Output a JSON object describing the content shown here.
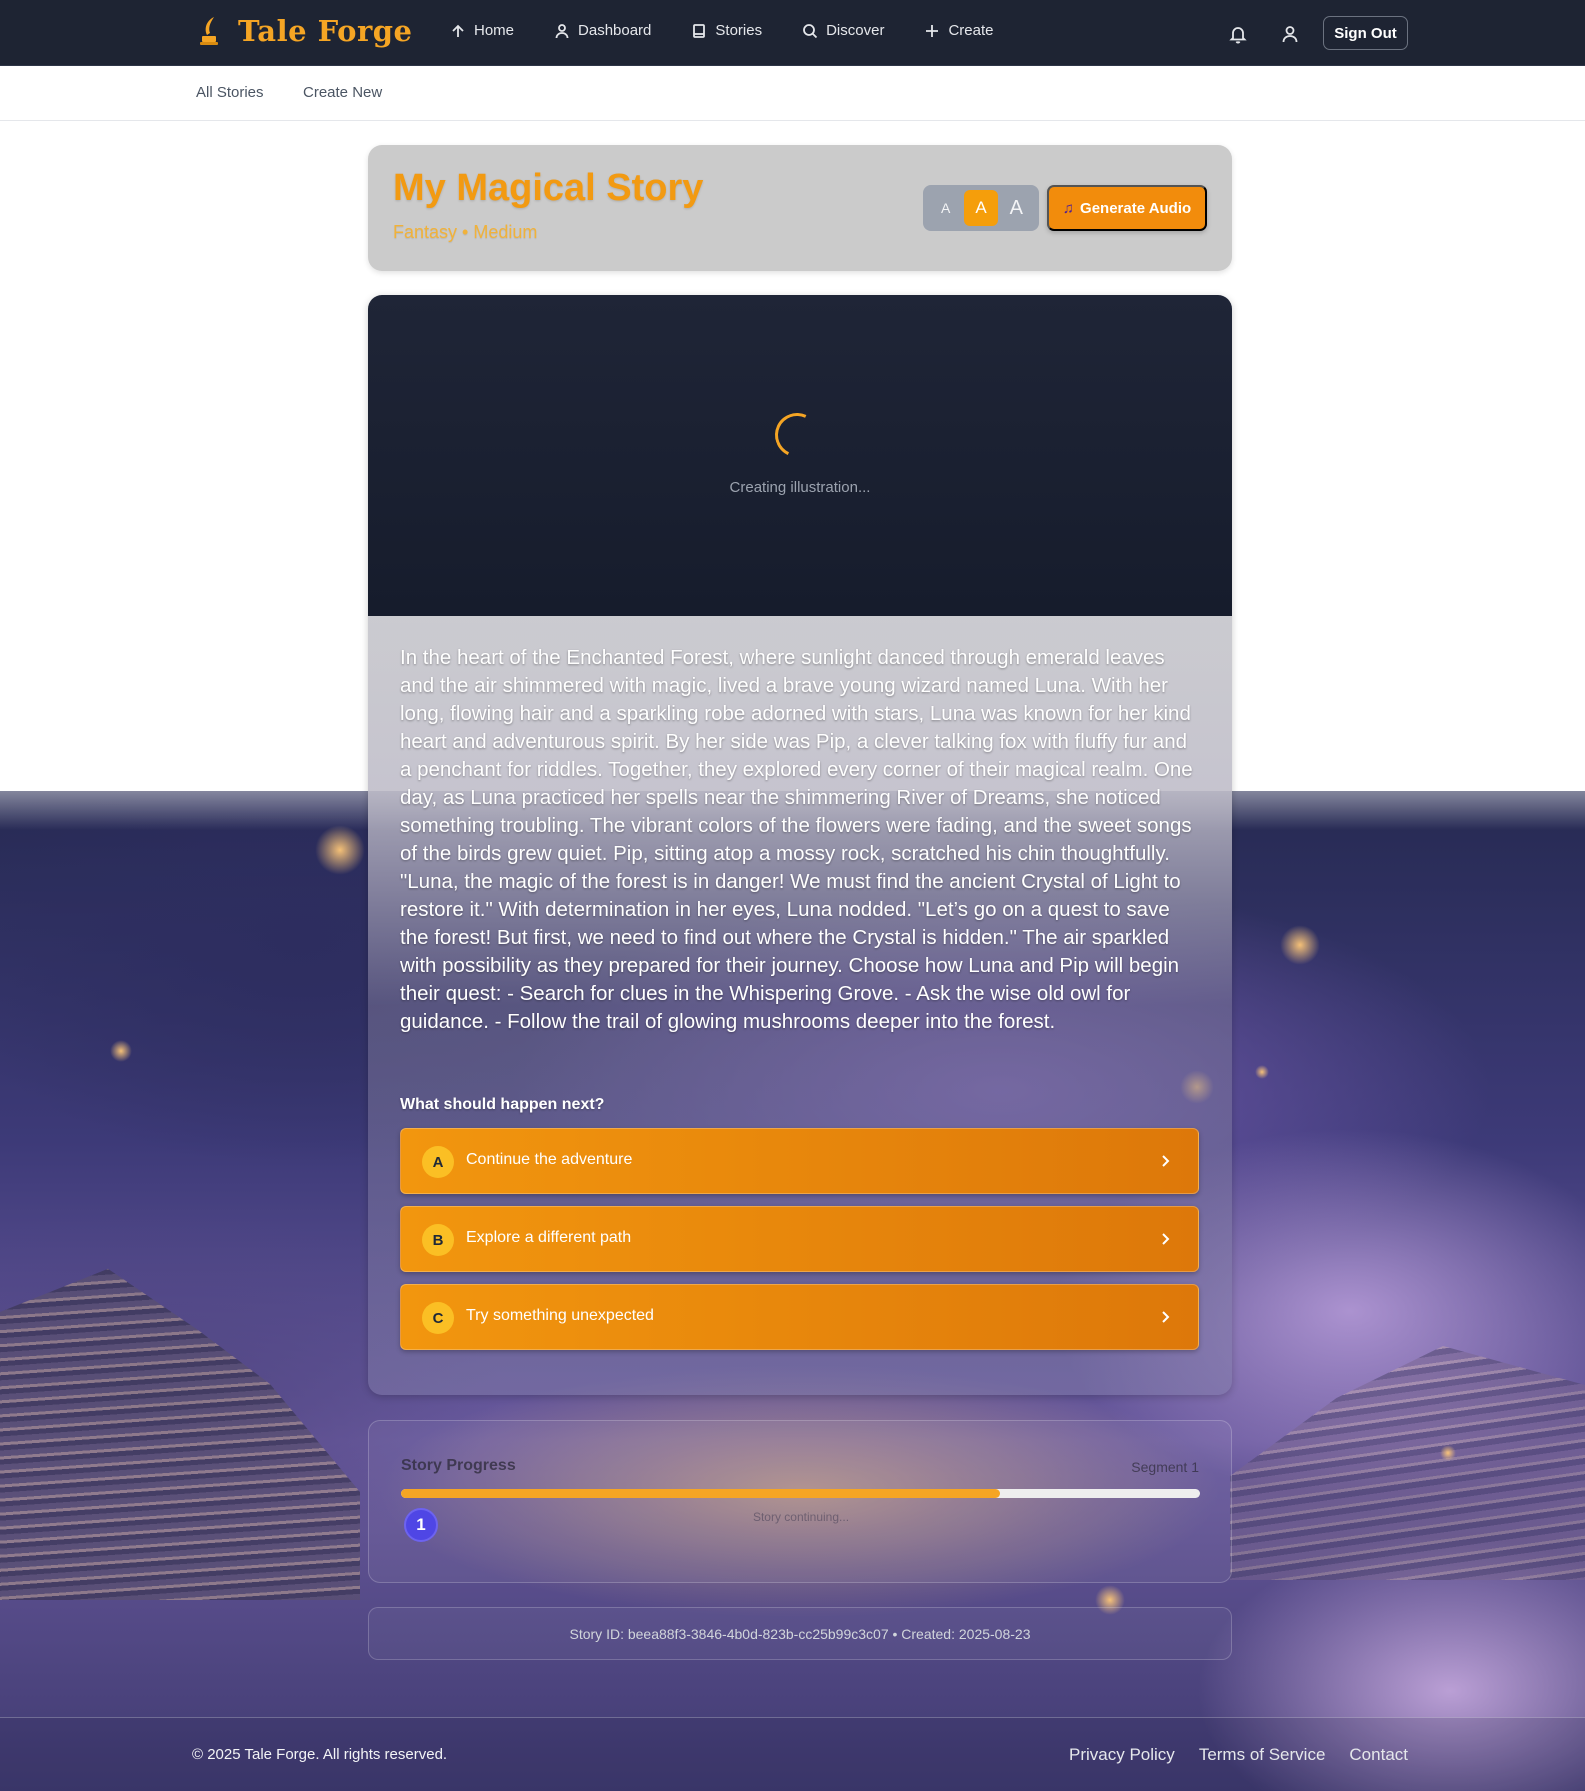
{
  "header": {
    "brand": "Tale Forge",
    "nav": [
      {
        "label": "Home",
        "icon": "home-icon"
      },
      {
        "label": "Dashboard",
        "icon": "user-icon"
      },
      {
        "label": "Stories",
        "icon": "book-icon"
      },
      {
        "label": "Discover",
        "icon": "search-icon"
      },
      {
        "label": "Create",
        "icon": "plus-icon"
      }
    ],
    "bell_icon": "bell-icon",
    "profile_icon": "user-icon",
    "signout_label": "Sign Out"
  },
  "subnav": {
    "all_stories": "All Stories",
    "create_new": "Create New"
  },
  "story": {
    "title": "My Magical Story",
    "meta": "Fantasy • Medium",
    "font_sizes": [
      "A",
      "A",
      "A"
    ],
    "selected_font_size": "medium",
    "generate_audio_label": "Generate Audio",
    "illustration_status": "Creating illustration...",
    "text": "In the heart of the Enchanted Forest, where sunlight danced through emerald leaves and the air shimmered with magic, lived a brave young wizard named Luna. With her long, flowing hair and a sparkling robe adorned with stars, Luna was known for her kind heart and adventurous spirit. By her side was Pip, a clever talking fox with fluffy fur and a penchant for riddles. Together, they explored every corner of their magical realm. One day, as Luna practiced her spells near the shimmering River of Dreams, she noticed something troubling. The vibrant colors of the flowers were fading, and the sweet songs of the birds grew quiet. Pip, sitting atop a mossy rock, scratched his chin thoughtfully. \"Luna, the magic of the forest is in danger! We must find the ancient Crystal of Light to restore it.\" With determination in her eyes, Luna nodded. \"Let’s go on a quest to save the forest! But first, we need to find out where the Crystal is hidden.\" The air sparkled with possibility as they prepared for their journey. Choose how Luna and Pip will begin their quest: - Search for clues in the Whispering Grove. - Ask the wise old owl for guidance. - Follow the trail of glowing mushrooms deeper into the forest.",
    "next_question": "What should happen next?",
    "choices": [
      {
        "letter": "A",
        "label": "Continue the adventure"
      },
      {
        "letter": "B",
        "label": "Explore a different path"
      },
      {
        "letter": "C",
        "label": "Try something unexpected"
      }
    ]
  },
  "progress": {
    "title": "Story Progress",
    "segment": "Segment 1",
    "fraction": 0.75,
    "current_segment": "1",
    "status": "Story continuing..."
  },
  "story_info": "Story ID: beea88f3-3846-4b0d-823b-cc25b99c3c07 • Created: 2025-08-23",
  "footer": {
    "copyright": "© 2025 Tale Forge. All rights reserved.",
    "links": [
      "Privacy Policy",
      "Terms of Service",
      "Contact"
    ]
  },
  "colors": {
    "accent": "#f5a524",
    "header_bg": "#1e2433",
    "progress_dot": "#4f46e5"
  }
}
